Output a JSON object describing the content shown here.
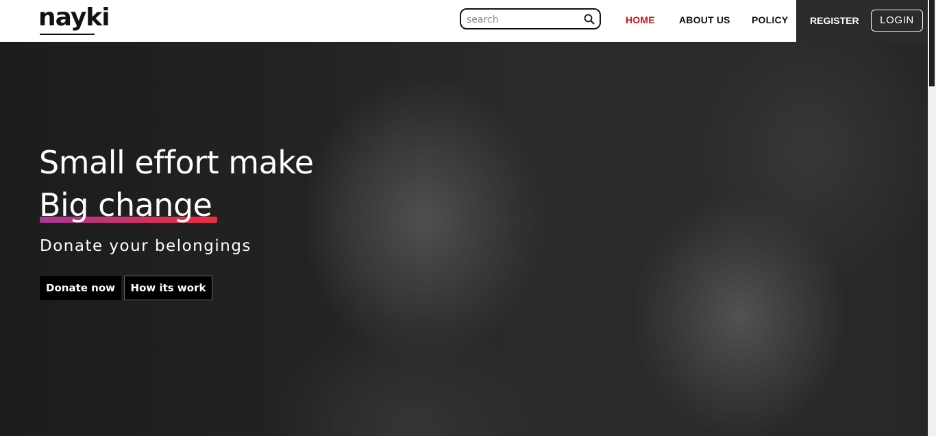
{
  "brand": {
    "logo_text": "nayki"
  },
  "search": {
    "placeholder": "search",
    "value": ""
  },
  "nav": {
    "items": [
      {
        "label": "HOME",
        "active": true
      },
      {
        "label": "ABOUT US",
        "active": false
      },
      {
        "label": "POLICY",
        "active": false
      }
    ],
    "register_label": "REGISTER",
    "login_label": "LOGIN"
  },
  "hero": {
    "headline_line1": "Small effort make",
    "headline_line2": "Big change",
    "subheadline": "Donate your belongings",
    "primary_button": "Donate now",
    "secondary_button": "How its work"
  },
  "colors": {
    "active_nav": "#cc1111",
    "underline_gradient_start": "#a93895",
    "underline_gradient_end": "#ee2d3c",
    "header_bg": "#ffffff",
    "header_dark_bg": "#2b2b2b"
  },
  "icons": {
    "search": "search-icon"
  }
}
